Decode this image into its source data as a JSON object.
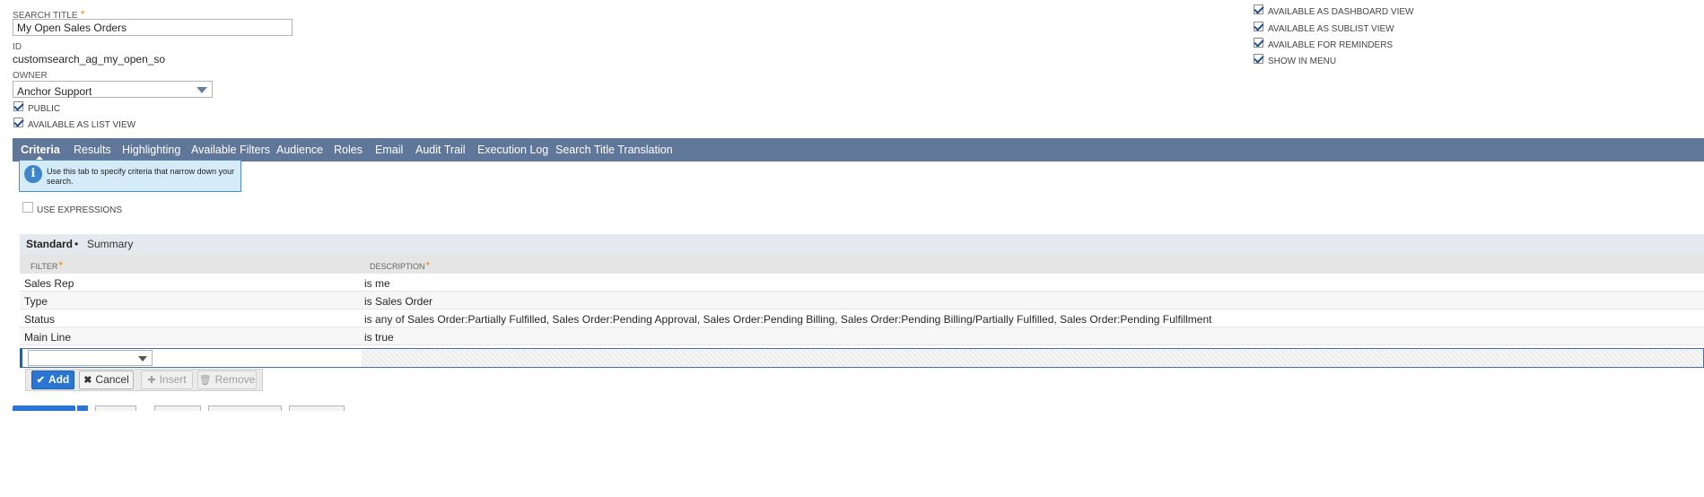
{
  "header": {
    "search_title": {
      "label": "SEARCH TITLE",
      "required_mark": "*",
      "value": "My Open Sales Orders"
    },
    "id": {
      "label": "ID",
      "value": "customsearch_ag_my_open_so"
    },
    "owner": {
      "label": "OWNER",
      "value": "Anchor Support"
    },
    "checkboxes_left": [
      {
        "label": "PUBLIC",
        "checked": true
      },
      {
        "label": "AVAILABLE AS LIST VIEW",
        "checked": true
      }
    ],
    "checkboxes_right": [
      {
        "label": "AVAILABLE AS DASHBOARD VIEW",
        "checked": true
      },
      {
        "label": "AVAILABLE AS SUBLIST VIEW",
        "checked": true
      },
      {
        "label": "AVAILABLE FOR REMINDERS",
        "checked": true
      },
      {
        "label": "SHOW IN MENU",
        "checked": true
      }
    ]
  },
  "tabs": [
    {
      "label": "Criteria",
      "active": true
    },
    {
      "label": "Results"
    },
    {
      "label": "Highlighting"
    },
    {
      "label": "Available Filters"
    },
    {
      "label": "Audience"
    },
    {
      "label": "Roles"
    },
    {
      "label": "Email"
    },
    {
      "label": "Audit Trail"
    },
    {
      "label": "Execution Log"
    },
    {
      "label": "Search Title Translation"
    }
  ],
  "info_box": {
    "icon": "info-icon",
    "text": "Use this tab to specify criteria that narrow down your search."
  },
  "use_expressions": {
    "label": "USE EXPRESSIONS",
    "checked": false
  },
  "subtabs": [
    {
      "label": "Standard",
      "active": true,
      "marker": "•"
    },
    {
      "label": "Summary"
    }
  ],
  "criteria_table": {
    "columns": [
      {
        "label": "FILTER",
        "required_mark": "*"
      },
      {
        "label": "DESCRIPTION",
        "required_mark": "*"
      }
    ],
    "rows": [
      {
        "filter": "Sales Rep",
        "description": "is me"
      },
      {
        "filter": "Type",
        "description": "is Sales Order"
      },
      {
        "filter": "Status",
        "description": "is any of Sales Order:Partially Fulfilled, Sales Order:Pending Approval, Sales Order:Pending Billing, Sales Order:Pending Billing/Partially Fulfilled, Sales Order:Pending Fulfillment"
      },
      {
        "filter": "Main Line",
        "description": "is true"
      }
    ],
    "edit_row": {
      "filter_value": ""
    }
  },
  "row_buttons": {
    "add": "Add",
    "cancel": "Cancel",
    "insert": "Insert",
    "remove": "Remove"
  },
  "colors": {
    "tabbar": "#607799",
    "primary_button": "#2a76d2",
    "info_bg": "#d5ecf8",
    "required": "#e88a00"
  }
}
